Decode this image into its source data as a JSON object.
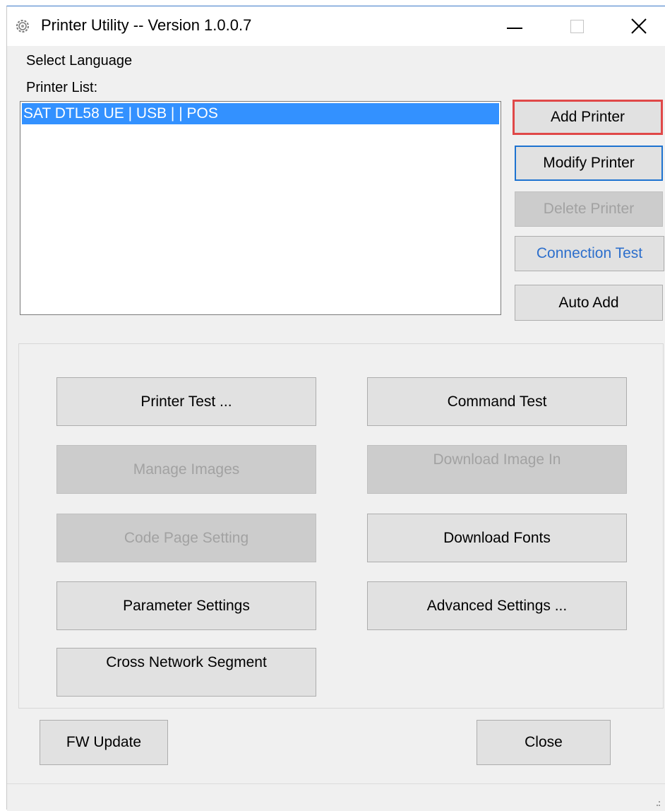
{
  "window": {
    "title": "Printer Utility -- Version 1.0.0.7",
    "app_icon": "gear-icon",
    "controls": {
      "minimize_icon": "minimize-icon",
      "maximize_icon": "maximize-icon",
      "close_icon": "close-icon"
    }
  },
  "menu": {
    "select_language": "Select Language"
  },
  "printer_list": {
    "label": "Printer List:",
    "items": [
      {
        "text": "SAT DTL58 UE | USB |  | POS",
        "selected": true
      }
    ]
  },
  "side_buttons": {
    "add": "Add Printer",
    "modify": "Modify Printer",
    "delete": "Delete Printer",
    "connection_test": "Connection Test",
    "auto_add": "Auto Add"
  },
  "main_buttons": {
    "printer_test": "Printer Test ...",
    "command_test": "Command Test",
    "manage_images": "Manage Images",
    "download_image": "Download Image In",
    "code_page": "Code Page Setting",
    "download_fonts": "Download Fonts",
    "parameter_settings": "Parameter Settings",
    "advanced_settings": "Advanced Settings ...",
    "cross_network": "Cross Network Segment"
  },
  "footer": {
    "fw_update": "FW Update",
    "close": "Close"
  },
  "colors": {
    "selection": "#3391ff",
    "accent_border": "#e04848",
    "focus_border": "#1e73d0",
    "link_text": "#2d6fcc"
  }
}
